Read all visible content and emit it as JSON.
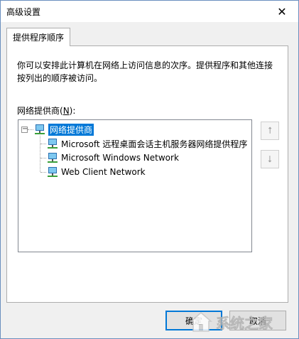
{
  "window": {
    "title": "高级设置",
    "close_glyph": "✕"
  },
  "tab": {
    "label": "提供程序顺序"
  },
  "description": "你可以安排此计算机在网络上访问信息的次序。提供程序和其他连接按列出的顺序被访问。",
  "list": {
    "label_prefix": "网络提供商(",
    "label_hotkey": "N",
    "label_suffix": "):",
    "root": {
      "label": "网络提供商",
      "icon": "network-icon",
      "expanded": true,
      "selected": true
    },
    "items": [
      {
        "label": "Microsoft 远程桌面会话主机服务器网络提供程序",
        "icon": "network-icon"
      },
      {
        "label": "Microsoft Windows Network",
        "icon": "network-icon"
      },
      {
        "label": "Web Client Network",
        "icon": "network-icon"
      }
    ]
  },
  "side_buttons": {
    "up_glyph": "⭡",
    "down_glyph": "⭣"
  },
  "buttons": {
    "ok_label": "确定",
    "cancel_label": "取消"
  },
  "watermark": {
    "text": "系统之家"
  },
  "colors": {
    "selection": "#0078d7",
    "window_border": "#6a8fbf",
    "dialog_bg": "#f0f0f0"
  }
}
